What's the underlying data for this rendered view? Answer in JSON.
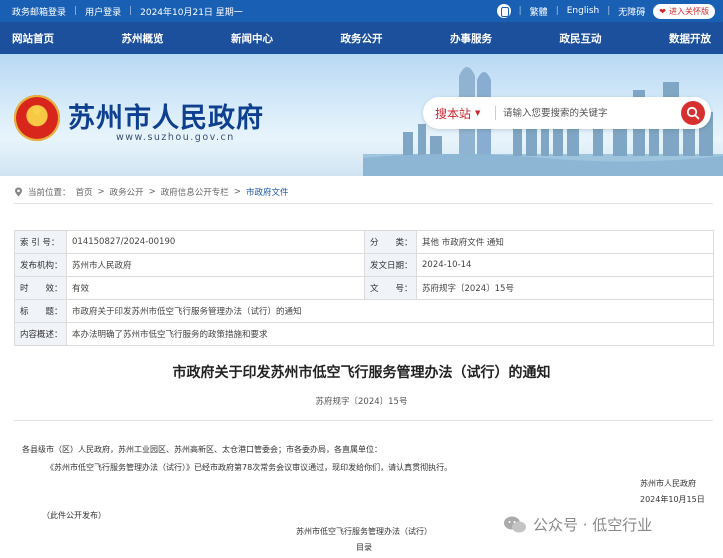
{
  "topbar": {
    "links_left": [
      "政务邮箱登录",
      "用户登录"
    ],
    "date": "2024年10月21日 星期一",
    "links_right": [
      "繁體",
      "English",
      "无障碍"
    ],
    "care_mode": "进入关怀版"
  },
  "nav": [
    "网站首页",
    "苏州概览",
    "新闻中心",
    "政务公开",
    "办事服务",
    "政民互动",
    "数据开放"
  ],
  "header": {
    "title": "苏州市人民政府",
    "url": "www.suzhou.gov.cn"
  },
  "search": {
    "scope": "搜本站",
    "placeholder": "请输入您要搜索的关键字"
  },
  "breadcrumb": {
    "prefix": "当前位置：",
    "items": [
      "首页",
      "政务公开",
      "政府信息公开专栏",
      "市政府文件"
    ],
    "separator": ">"
  },
  "meta": {
    "index_label": "索 引 号：",
    "index_value": "014150827/2024-00190",
    "category_label": "分　　类：",
    "category_value": "其他 市政府文件 通知",
    "issuer_label": "发布机构：",
    "issuer_value": "苏州市人民政府",
    "date_label": "发文日期：",
    "date_value": "2024-10-14",
    "validity_label": "时　　效：",
    "validity_value": "有效",
    "docno_label": "文　　号：",
    "docno_value": "苏府规字〔2024〕15号",
    "subject_label": "标　　题：",
    "subject_value": "市政府关于印发苏州市低空飞行服务管理办法（试行）的通知",
    "summary_label": "内容概述：",
    "summary_value": "本办法明确了苏州市低空飞行服务的政策措施和要求"
  },
  "document": {
    "title": "市政府关于印发苏州市低空飞行服务管理办法（试行）的通知",
    "number": "苏府规字〔2024〕15号",
    "recipients": "各县级市（区）人民政府，苏州工业园区、苏州高新区、太仓港口管委会；市各委办局，各直属单位：",
    "body": "《苏州市低空飞行服务管理办法（试行）》已经市政府第78次常务会议审议通过，现印发给你们，请认真贯彻执行。",
    "signer": "苏州市人民政府",
    "sign_date": "2024年10月15日",
    "publish_note": "（此件公开发布）",
    "attachment_title": "苏州市低空飞行服务管理办法（试行）",
    "toc": "目录"
  },
  "watermark": "公众号 · 低空行业",
  "colors": {
    "topbar": "#1960b4",
    "nav": "#1c4f9c",
    "title": "#0f3f8f",
    "accent_red": "#d63030"
  }
}
